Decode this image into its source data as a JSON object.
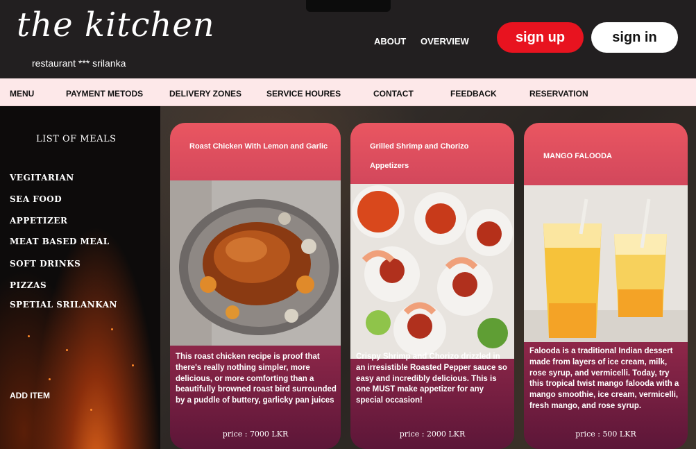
{
  "header": {
    "logo": "the kitchen",
    "tagline": "restaurant  ***  srilanka",
    "links": [
      "ABOUT",
      "OVERVIEW"
    ],
    "signup_label": "sign up",
    "signin_label": "sign in"
  },
  "nav": {
    "items": [
      "MENU",
      "PAYMENT METODS",
      "DELIVERY ZONES",
      "SERVICE HOURES",
      "CONTACT",
      "FEEDBACK",
      "RESERVATION"
    ]
  },
  "sidebar": {
    "title": "LIST OF MEALS",
    "items": [
      "VEGITARIAN",
      "SEA FOOD",
      "APPETIZER",
      "MEAT BASED MEAL",
      "SOFT DRINKS",
      "PIZZAS",
      "SPETIAL SRILANKAN"
    ],
    "add_item": "ADD ITEM"
  },
  "cards": [
    {
      "title": "Roast Chicken With Lemon and Garlic",
      "description": "This roast chicken recipe is proof that there's really nothing simpler, more delicious, or more comforting than a beautifully browned roast bird surrounded by a puddle of buttery, garlicky pan juices",
      "price": "price  :  7000 LKR"
    },
    {
      "title": "Grilled Shrimp and Chorizo Appetizers",
      "description": "Crispy Shrimp and Chorizo drizzled in an irresistible Roasted Pepper sauce so easy and incredibly delicious. This is one MUST make appetizer for any special occasion!",
      "price": "price  :  2000 LKR"
    },
    {
      "title": "MANGO FALOODA",
      "description": "Falooda is a traditional Indian dessert made from layers of ice cream, milk, rose syrup, and vermicelli. Today, try this tropical twist mango falooda with a mango smoothie, ice cream, vermicelli, fresh mango, and rose syrup.",
      "price": "price  :  500 LKR"
    }
  ],
  "colors": {
    "header_bg": "#221f20",
    "nav_bg": "#fde8e9",
    "signup_bg": "#e8131f",
    "card_top": "#ea5661",
    "card_bottom": "#5c1638"
  }
}
